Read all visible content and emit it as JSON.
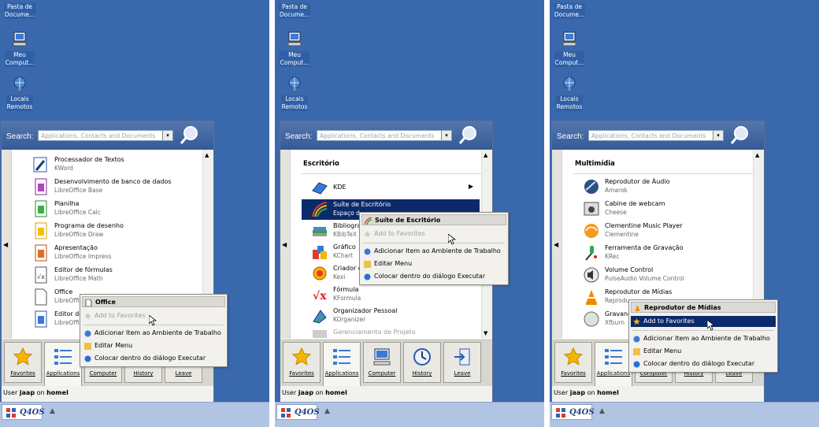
{
  "desktop": {
    "icons": [
      {
        "label_line1": "Pasta de",
        "label_line2": "Docume...",
        "icon": "folder-icon"
      },
      {
        "label_line1": "Meu",
        "label_line2": "Comput...",
        "icon": "computer-icon"
      },
      {
        "label_line1": "Locais",
        "label_line2": "Remotos",
        "icon": "network-globe-icon"
      }
    ]
  },
  "menu": {
    "search_label": "Search:",
    "search_placeholder": "Applications, Contacts and Documents",
    "tabs": [
      "Favorites",
      "Applications",
      "Computer",
      "History",
      "Leave"
    ],
    "user_prefix": "User",
    "user_name": "jaap",
    "user_mid": "on",
    "host_name": "homel"
  },
  "taskbar": {
    "start_label": "Q4OS"
  },
  "panel1": {
    "items": [
      {
        "name": "Processador de Textos",
        "sub": "KWord"
      },
      {
        "name": "Desenvolvimento de banco de dados",
        "sub": "LibreOffice Base"
      },
      {
        "name": "Planilha",
        "sub": "LibreOffice Calc"
      },
      {
        "name": "Programa de desenho",
        "sub": "LibreOffice Draw"
      },
      {
        "name": "Apresentação",
        "sub": "LibreOffice Impress"
      },
      {
        "name": "Editor de fórmulas",
        "sub": "LibreOffice Math"
      },
      {
        "name": "Office",
        "sub": "LibreOffi"
      },
      {
        "name": "Editor de",
        "sub": "LibreOffi"
      }
    ],
    "context": {
      "title": "Office",
      "add_fav": "Add to Favorites",
      "add_desktop": "Adicionar Item ao Ambiente de Trabalho",
      "edit_menu": "Editar Menu",
      "run_dialog": "Colocar dentro do diálogo Executar"
    }
  },
  "panel2": {
    "category": "Escritório",
    "items": [
      {
        "name": "KDE",
        "sub": ""
      },
      {
        "name": "Suíte de Escritório",
        "sub": "Espaço d"
      },
      {
        "name": "Bibliogra",
        "sub": "KBibTeX"
      },
      {
        "name": "Gráfico",
        "sub": "KChart"
      },
      {
        "name": "Criador d",
        "sub": "Kexi"
      },
      {
        "name": "Fórmula",
        "sub": "KFormula"
      },
      {
        "name": "Organizador Pessoal",
        "sub": "KOrganizer"
      },
      {
        "name": "Gerenciamento de Projeto",
        "sub": ""
      }
    ],
    "context": {
      "title": "Suíte de Escritório",
      "add_fav": "Add to Favorites",
      "add_desktop": "Adicionar Item ao Ambiente de Trabalho",
      "edit_menu": "Editar Menu",
      "run_dialog": "Colocar dentro do diálogo Executar"
    }
  },
  "panel3": {
    "category": "Multimídia",
    "items": [
      {
        "name": "Reprodutor de Áudio",
        "sub": "Amarok"
      },
      {
        "name": "Cabine de webcam",
        "sub": "Cheese"
      },
      {
        "name": "Clementine Music Player",
        "sub": "Clementine"
      },
      {
        "name": "Ferramenta de Gravação",
        "sub": "KRec"
      },
      {
        "name": "Volume Control",
        "sub": "PulseAudio Volume Control"
      },
      {
        "name": "Reprodutor de Mídias",
        "sub": "Reprodu"
      },
      {
        "name": "Gravand",
        "sub": "Xfburn"
      }
    ],
    "context": {
      "title": "Reprodutor de Mídias",
      "add_fav": "Add to Favorites",
      "add_desktop": "Adicionar Item ao Ambiente de Trabalho",
      "edit_menu": "Editar Menu",
      "run_dialog": "Colocar dentro do diálogo Executar"
    }
  },
  "colors": {
    "desktop": "#3a68ad",
    "selection": "#0b2a6b",
    "taskbar": "#b1c4e4"
  }
}
